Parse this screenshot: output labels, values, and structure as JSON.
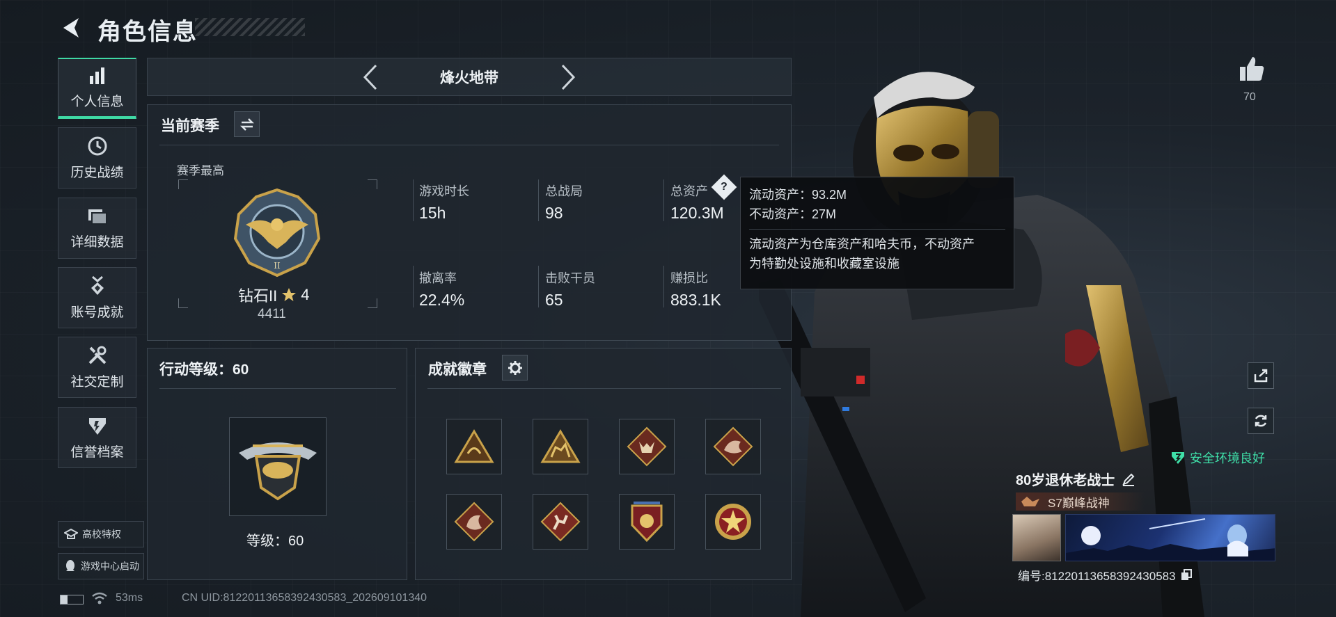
{
  "header": {
    "title": "角色信息"
  },
  "sidebar": {
    "items": [
      {
        "label": "个人信息",
        "icon": "bar-chart-icon",
        "active": true
      },
      {
        "label": "历史战绩",
        "icon": "history-clock-icon"
      },
      {
        "label": "详细数据",
        "icon": "folder-icon"
      },
      {
        "label": "账号成就",
        "icon": "medal-icon"
      },
      {
        "label": "社交定制",
        "icon": "tools-icon"
      },
      {
        "label": "信誉档案",
        "icon": "shield-icon"
      }
    ],
    "extras": [
      {
        "label": "高校特权",
        "icon": "school-icon"
      },
      {
        "label": "游戏中心启动",
        "icon": "qq-icon"
      }
    ]
  },
  "mode": {
    "title": "烽火地带"
  },
  "season": {
    "title": "当前赛季",
    "best_label": "赛季最高",
    "rank_name": "钻石II",
    "rank_stars": "4",
    "rank_score": "4411",
    "stats": [
      {
        "label": "游戏时长",
        "value": "15h"
      },
      {
        "label": "总战局",
        "value": "98"
      },
      {
        "label": "总资产",
        "value": "120.3M"
      },
      {
        "label": "撤离率",
        "value": "22.4%"
      },
      {
        "label": "击败干员",
        "value": "65"
      },
      {
        "label": "赚损比",
        "value": "883.1K"
      }
    ]
  },
  "tooltip": {
    "line1": "流动资产：93.2M",
    "line2": "不动资产：27M",
    "note1": "流动资产为仓库资产和哈夫币，不动资产",
    "note2": "为特勤处设施和收藏室设施"
  },
  "action_level": {
    "title": "行动等级：60",
    "level_text": "等级：60"
  },
  "badges": {
    "title": "成就徽章",
    "items": [
      "triangle-badge",
      "triangle-camel-badge",
      "wolf-badge",
      "dragon-badge",
      "dragon-badge-2",
      "runner-badge",
      "shield-badge",
      "star-badge"
    ]
  },
  "likes": {
    "count": "70"
  },
  "player": {
    "safety": "安全环境良好",
    "name": "80岁退休老战士",
    "title_badge": "S7巅峰战神",
    "uid_line": "编号:81220113658392430583"
  },
  "footer": {
    "ping": "53ms",
    "uid": "CN UID:81220113658392430583_202609101340"
  },
  "colors": {
    "accent": "#3fd9a4",
    "background": "#1b222a",
    "gold": "#c9a24a"
  }
}
